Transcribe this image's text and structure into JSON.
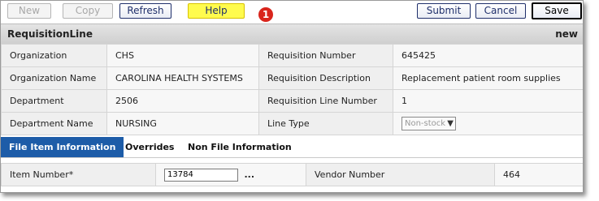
{
  "toolbar": {
    "new_label": "New",
    "copy_label": "Copy",
    "refresh_label": "Refresh",
    "help_label": "Help",
    "callout_number": "1",
    "submit_label": "Submit",
    "cancel_label": "Cancel",
    "save_label": "Save"
  },
  "header": {
    "title": "RequisitionLine",
    "status": "new"
  },
  "fields": {
    "organization_label": "Organization",
    "organization_value": "CHS",
    "requisition_number_label": "Requisition Number",
    "requisition_number_value": "645425",
    "organization_name_label": "Organization Name",
    "organization_name_value": "CAROLINA HEALTH SYSTEMS",
    "requisition_description_label": "Requisition Description",
    "requisition_description_value": "Replacement patient room supplies",
    "department_label": "Department",
    "department_value": "2506",
    "requisition_line_number_label": "Requisition Line Number",
    "requisition_line_number_value": "1",
    "department_name_label": "Department Name",
    "department_name_value": "NURSING",
    "line_type_label": "Line Type",
    "line_type_value": "Non-stock"
  },
  "tabs": [
    {
      "label": "File Item Information",
      "active": true
    },
    {
      "label": "Overrides",
      "active": false
    },
    {
      "label": "Non File Information",
      "active": false
    }
  ],
  "item": {
    "item_number_label": "Item Number*",
    "item_number_value": "13784",
    "lookup_label": "...",
    "vendor_number_label": "Vendor Number",
    "vendor_number_value": "464"
  },
  "colors": {
    "active_tab": "#1d5ca8",
    "help_button": "#fffb4d",
    "callout_badge": "#d9251c"
  }
}
